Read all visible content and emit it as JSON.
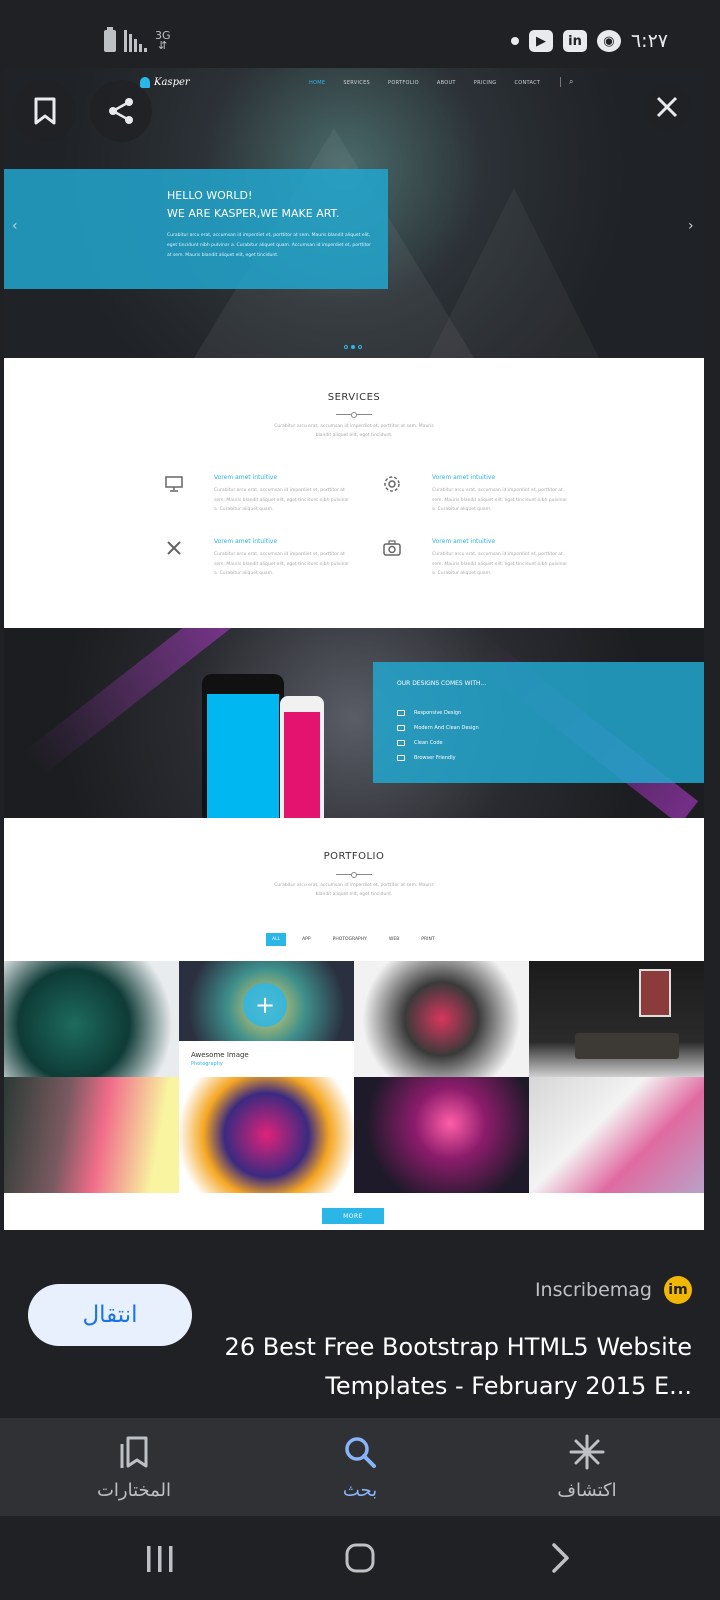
{
  "status_bar": {
    "network": "3G",
    "clock": "٦:٢٧",
    "apps": [
      "youtube-icon",
      "linkedin-icon",
      "chrome-icon"
    ]
  },
  "preview": {
    "site": {
      "logo": "Kasper",
      "menu": [
        "HOME",
        "SERVICES",
        "PORTFOLIO",
        "ABOUT",
        "PRICING",
        "CONTACT"
      ],
      "hero_line1": "HELLO WORLD!",
      "hero_line2": "WE ARE KASPER,WE MAKE ART.",
      "hero_text": "Curabitur arcu erat, accumsan id imperdiet et, porttitor at sem. Mauris blandit aliquet elit, eget tincidunt nibh pulvinar a. Curabitur aliquet quam. Accumsan id imperdiet et, porttitor at sem. Mauris blandit aliquet elit, eget tincidunt.",
      "services_title": "SERVICES",
      "services_sub": "Curabitur arcu erat, accumsan id imperdiet et, porttitor at sem. Mauris blandit aliquet elit, eget tincidunt.",
      "services": [
        {
          "title": "Vorem amet intuitive",
          "text": "Curabitur arcu erat, accumsan id imperdiet et, porttitor at sem. Mauris blandit aliquet elit, eget tincidunt nibh pulvinar a. Curabitur aliquet quam."
        },
        {
          "title": "Vorem amet intuitive",
          "text": "Curabitur arcu erat, accumsan id imperdiet et, porttitor at sem. Mauris blandit aliquet elit, eget tincidunt nibh pulvinar a. Curabitur aliquet quam."
        },
        {
          "title": "Vorem amet intuitive",
          "text": "Curabitur arcu erat, accumsan id imperdiet et, porttitor at sem. Mauris blandit aliquet elit, eget tincidunt nibh pulvinar a. Curabitur aliquet quam."
        },
        {
          "title": "Vorem amet intuitive",
          "text": "Curabitur arcu erat, accumsan id imperdiet et, porttitor at sem. Mauris blandit aliquet elit, eget tincidunt nibh pulvinar a. Curabitur aliquet quam."
        }
      ],
      "designs_title": "OUR DESIGNS COMES WITH...",
      "designs_items": [
        "Responsive Design",
        "Modern And Clean Design",
        "Clean Code",
        "Browser Friendly"
      ],
      "portfolio_title": "PORTFOLIO",
      "portfolio_sub": "Curabitur arcu erat, accumsan id imperdiet et, porttitor at sem. Mauris blandit aliquet elit, eget tincidunt.",
      "filters": [
        "ALL",
        "APP",
        "PHOTOGRAPHY",
        "WEB",
        "PRINT"
      ],
      "caption_title": "Awesome Image",
      "caption_sub": "Photography",
      "more": "MORE"
    }
  },
  "info": {
    "visit_label": "انتقال",
    "source_name": "Inscribemag",
    "source_logo": "im",
    "title": "26 Best Free Bootstrap HTML5 Website Templates - February 2015 E..."
  },
  "bottom_nav": {
    "items": [
      {
        "label": "اكتشاف",
        "icon": "asterisk-icon"
      },
      {
        "label": "بحث",
        "icon": "search-icon"
      },
      {
        "label": "المختارات",
        "icon": "collections-icon"
      }
    ]
  },
  "colors": {
    "accent": "#2bb6e8",
    "link_blue": "#8ab4f8",
    "button_text": "#1a73e8",
    "background": "#202124"
  }
}
